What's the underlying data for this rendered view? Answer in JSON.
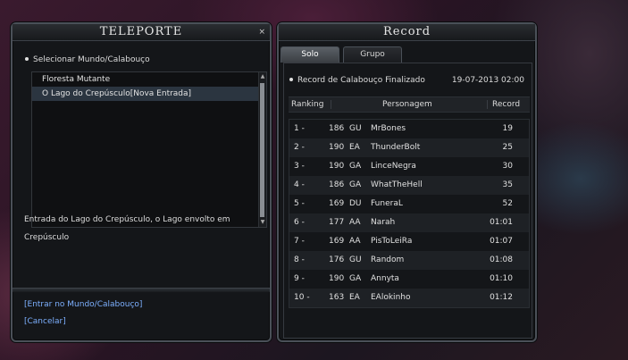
{
  "teleport": {
    "title": "TELEPORTE",
    "close": "×",
    "heading": "Selecionar Mundo/Calabouço",
    "items": [
      "Floresta Mutante",
      "O Lago do Crepúsculo[Nova Entrada]"
    ],
    "selected_index": 1,
    "description_line1": "Entrada do Lago do Crepúsculo, o Lago envolto em",
    "description_line2": "Crepúsculo",
    "enter_link": "[Entrar no Mundo/Calabouço]",
    "cancel_link": "[Cancelar]",
    "scroll_up": "▲",
    "scroll_down": "▼"
  },
  "record": {
    "title": "Record",
    "tabs": [
      "Solo",
      "Grupo"
    ],
    "active_tab": 0,
    "heading": "Record de Calabouço Finalizado",
    "date": "19-07-2013 02:00",
    "columns": {
      "ranking": "Ranking",
      "personagem": "Personagem",
      "record": "Record"
    },
    "rows": [
      {
        "rank": "1 -",
        "level": "186",
        "cls": "GU",
        "name": "MrBones",
        "record": "19"
      },
      {
        "rank": "2 -",
        "level": "190",
        "cls": "EA",
        "name": "ThunderBolt",
        "record": "25"
      },
      {
        "rank": "3 -",
        "level": "190",
        "cls": "GA",
        "name": "LinceNegra",
        "record": "30"
      },
      {
        "rank": "4 -",
        "level": "186",
        "cls": "GA",
        "name": "WhatTheHell",
        "record": "35"
      },
      {
        "rank": "5 -",
        "level": "169",
        "cls": "DU",
        "name": "FuneraL",
        "record": "52"
      },
      {
        "rank": "6 -",
        "level": "177",
        "cls": "AA",
        "name": "Narah",
        "record": "01:01"
      },
      {
        "rank": "7 -",
        "level": "169",
        "cls": "AA",
        "name": "PisToLeiRa",
        "record": "01:07"
      },
      {
        "rank": "8 -",
        "level": "176",
        "cls": "GU",
        "name": "Random",
        "record": "01:08"
      },
      {
        "rank": "9 -",
        "level": "190",
        "cls": "GA",
        "name": "Annyta",
        "record": "01:10"
      },
      {
        "rank": "10 -",
        "level": "163",
        "cls": "EA",
        "name": "EAlokinho",
        "record": "01:12"
      }
    ]
  }
}
